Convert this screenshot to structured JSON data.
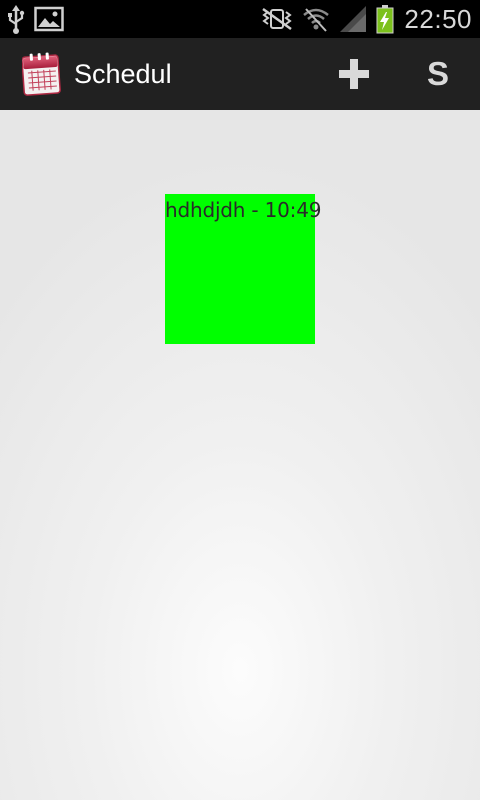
{
  "status_bar": {
    "time": "22:50",
    "icons": [
      "usb-icon",
      "image-notification-icon",
      "mute-vibrate-icon",
      "wifi-icon",
      "signal-icon",
      "battery-charging-icon"
    ]
  },
  "action_bar": {
    "app_icon": "calendar-icon",
    "title": "Schedul",
    "add_icon": "plus-icon",
    "s_label": "S"
  },
  "content": {
    "event": {
      "label": "hdhdjdh - 10:49",
      "color": "#00ff00"
    }
  },
  "colors": {
    "status_bar_bg": "#000000",
    "action_bar_bg": "#212121",
    "content_bg": "#e7e7e7",
    "event_bg": "#00ff00"
  }
}
